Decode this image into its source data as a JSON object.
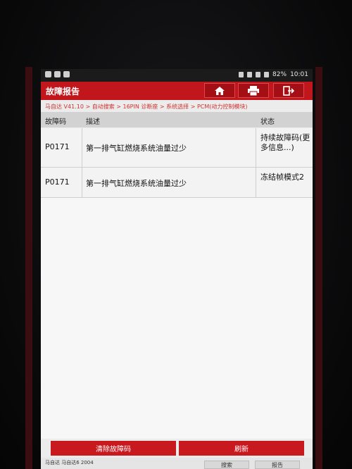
{
  "status_bar": {
    "battery": "82%",
    "time": "10:01"
  },
  "header": {
    "title": "故障报告"
  },
  "breadcrumb": "马自达 V41.10 > 自动搜索 > 16PIN 诊断座 > 系统选择 > PCM(动力控制模块)",
  "table": {
    "columns": {
      "code": "故障码",
      "desc": "描述",
      "status": "状态"
    },
    "rows": [
      {
        "code": "P0171",
        "desc": "第一排气缸燃烧系统油量过少",
        "status": "持续故障码(更多信息...)"
      },
      {
        "code": "P0171",
        "desc": "第一排气缸燃烧系统油量过少",
        "status": "冻结帧模式2"
      }
    ]
  },
  "actions": {
    "clear": "清除故障码",
    "refresh": "刷新"
  },
  "footer": {
    "info": "马自达 马自达6 2004",
    "search": "搜索",
    "report": "报告"
  },
  "colors": {
    "brand_red": "#c1161c",
    "header_gray": "#d2d2d2"
  },
  "icons": [
    "home-icon",
    "print-icon",
    "exit-icon"
  ]
}
